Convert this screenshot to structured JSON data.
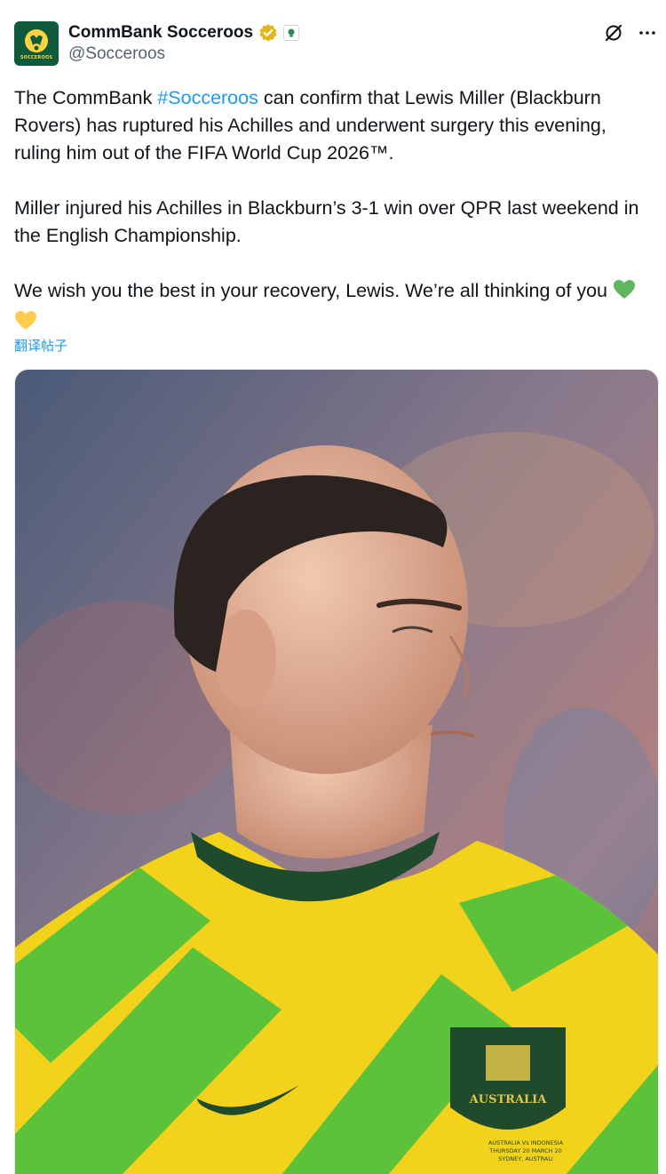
{
  "author": {
    "display_name": "CommBank Socceroos",
    "handle": "@Socceroos",
    "avatar_label": "SOCCEROOS",
    "verified_icon": "gold-verified-badge",
    "affiliate_icon": "affiliate-badge"
  },
  "actions": {
    "grok_icon": "grok-icon",
    "more_icon": "more-options-icon"
  },
  "post": {
    "p1_before": "The CommBank ",
    "hashtag": "#Socceroos",
    "p1_after": " can confirm that Lewis Miller (Blackburn Rovers) has ruptured his Achilles and underwent surgery this evening, ruling him out of the FIFA World Cup 2026™.",
    "p2": "Miller injured his Achilles in Blackburn’s 3-1 win over QPR last weekend in the English Championship.",
    "p3": "We wish you the best in your recovery, Lewis. We’re all thinking of you",
    "emojis": [
      "green-heart",
      "yellow-heart"
    ]
  },
  "translate_link": "翻译帖子",
  "media": {
    "badge_text": "AUSTRALIA",
    "caption_lines": [
      "AUSTRALIA Vs INDONESIA",
      "THURSDAY 20 MARCH 20",
      "SYDNEY, AUSTRALI"
    ],
    "colors": {
      "jersey_yellow": "#f2d21a",
      "jersey_green": "#5cc23a",
      "collar": "#1f4a2c"
    }
  },
  "colors": {
    "link": "#1d9bf0",
    "text": "#0f1419",
    "muted": "#536471"
  }
}
